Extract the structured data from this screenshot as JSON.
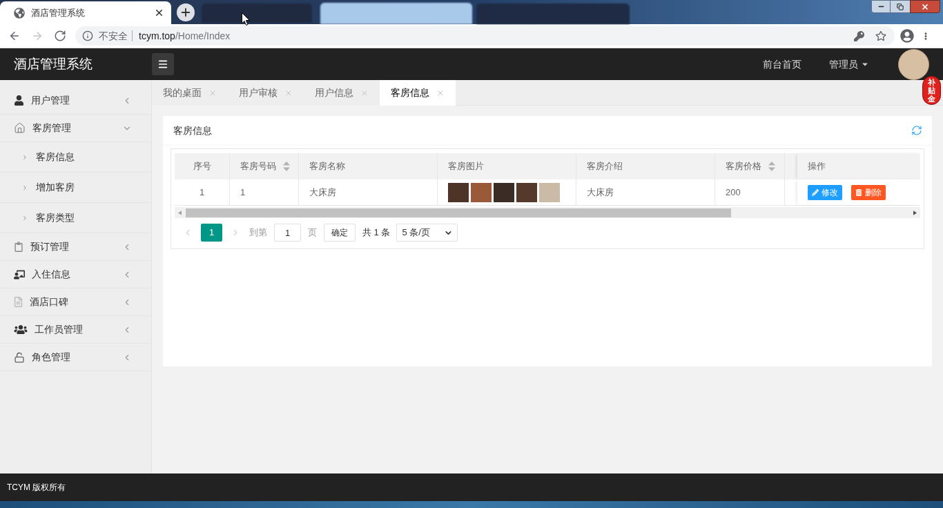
{
  "browser": {
    "tabs": [
      {
        "title": "酒店管理系统",
        "selected": true
      }
    ],
    "nav": [
      {
        "kind": "back",
        "disabled": false
      },
      {
        "kind": "forward",
        "disabled": true
      },
      {
        "kind": "reload",
        "disabled": false
      }
    ],
    "address": {
      "security": "不安全",
      "host": "tcym.top",
      "path": "/Home/Index"
    }
  },
  "header": {
    "title": "酒店管理系统",
    "nav": [
      {
        "label": "前台首页",
        "kind": "link"
      },
      {
        "label": "管理员",
        "kind": "menu"
      }
    ]
  },
  "sidebar": {
    "items": [
      {
        "label": "用户管理",
        "expanded": false
      },
      {
        "label": "客房管理",
        "expanded": true,
        "children": [
          {
            "label": "客房信息"
          },
          {
            "label": "增加客房"
          },
          {
            "label": "客房类型"
          }
        ]
      },
      {
        "label": "预订管理",
        "expanded": false
      },
      {
        "label": "入住信息",
        "expanded": false
      },
      {
        "label": "酒店口碑",
        "expanded": false
      },
      {
        "label": "工作员管理",
        "expanded": false
      },
      {
        "label": "角色管理",
        "expanded": false
      }
    ]
  },
  "page_tabs": [
    {
      "label": "我的桌面",
      "selected": false
    },
    {
      "label": "用户审核",
      "selected": false
    },
    {
      "label": "用户信息",
      "selected": false
    },
    {
      "label": "客房信息",
      "selected": true
    }
  ],
  "card": {
    "title": "客房信息"
  },
  "table": {
    "columns": [
      {
        "label": "序号",
        "sortable": false
      },
      {
        "label": "客房号码",
        "sortable": true
      },
      {
        "label": "客房名称",
        "sortable": false
      },
      {
        "label": "客房图片",
        "sortable": false
      },
      {
        "label": "客房介绍",
        "sortable": false
      },
      {
        "label": "客房价格",
        "sortable": true
      },
      {
        "label": "操作",
        "sortable": false
      }
    ],
    "rows": [
      {
        "index": "1",
        "number": "1",
        "name": "大床房",
        "photos": [
          {
            "kind": "photo"
          },
          {
            "kind": "photo"
          },
          {
            "kind": "photo"
          },
          {
            "kind": "photo"
          },
          {
            "kind": "photo"
          }
        ],
        "intro": "大床房",
        "price": "200",
        "actions": [
          {
            "label": "修改",
            "kind": "edit"
          },
          {
            "label": "删除",
            "kind": "delete"
          }
        ]
      }
    ]
  },
  "pagination": {
    "prev": {
      "disabled": true
    },
    "pages": [
      {
        "label": "1",
        "selected": true
      }
    ],
    "next": {
      "disabled": true
    },
    "goto_label": "到第",
    "goto_value": "1",
    "page_unit": "页",
    "confirm": "确定",
    "total": "共 1 条",
    "page_size": "5 条/页"
  },
  "footer": {
    "text": "TCYM 版权所有"
  },
  "badge": {
    "text": "补贴金"
  }
}
